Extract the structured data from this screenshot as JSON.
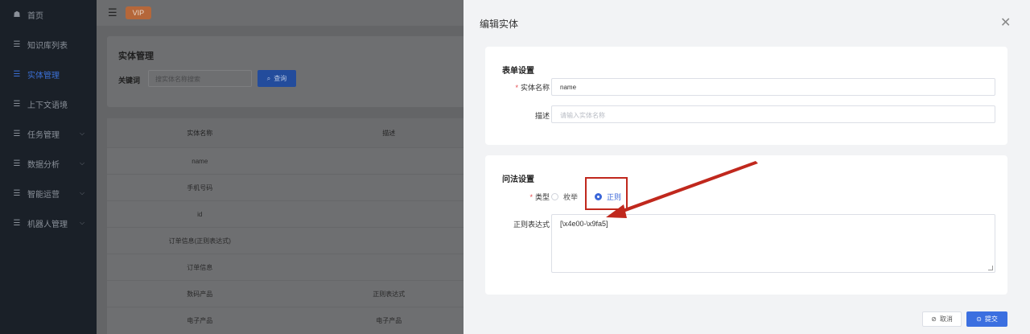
{
  "sidebar": {
    "items": [
      {
        "label": "首页",
        "icon": "home-icon"
      },
      {
        "label": "知识库列表",
        "icon": "list-icon"
      },
      {
        "label": "实体管理",
        "icon": "list-icon",
        "active": true
      },
      {
        "label": "上下文语境",
        "icon": "list-icon"
      },
      {
        "label": "任务管理",
        "icon": "list-icon",
        "has_children": true
      },
      {
        "label": "数据分析",
        "icon": "list-icon",
        "has_children": true
      },
      {
        "label": "智能运营",
        "icon": "list-icon",
        "has_children": true
      },
      {
        "label": "机器人管理",
        "icon": "list-icon",
        "has_children": true
      }
    ]
  },
  "topbar": {
    "badge": "VIP"
  },
  "page": {
    "title": "实体管理",
    "search_label": "关键词",
    "search_placeholder": "搜实体名称搜索",
    "search_button": "查询"
  },
  "table": {
    "headers": [
      "实体名称",
      "描述"
    ],
    "rows": [
      [
        "name",
        ""
      ],
      [
        "手机号码",
        ""
      ],
      [
        "id",
        ""
      ],
      [
        "订单信息(正则表达式)",
        ""
      ],
      [
        "订单信息",
        ""
      ],
      [
        "数码产品",
        "正则表达式"
      ],
      [
        "电子产品",
        "电子产品"
      ]
    ]
  },
  "drawer": {
    "title": "编辑实体",
    "form_section": "表单设置",
    "entity_name_label": "实体名称",
    "entity_name_value": "name",
    "desc_label": "描述",
    "desc_placeholder": "请输入实体名称",
    "qa_section": "问法设置",
    "type_label": "类型",
    "type_options": [
      "枚举",
      "正则"
    ],
    "type_selected": "正则",
    "regex_label": "正则表达式",
    "regex_value": "[\\x4e00-\\x9fa5]",
    "cancel": "取消",
    "submit": "提交"
  },
  "colors": {
    "accent": "#3b6fe0",
    "highlight": "#c0281d",
    "sidebar": "#1a2028"
  }
}
